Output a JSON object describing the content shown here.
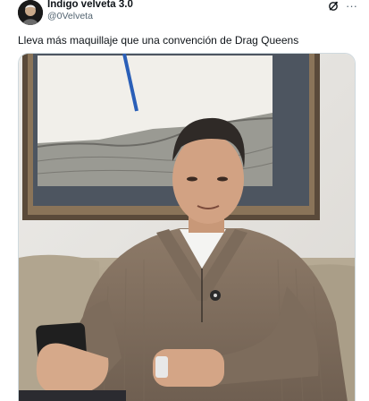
{
  "tweet": {
    "author": {
      "display_name": "Indigo velveta 3.0",
      "handle": "@0Velveta",
      "avatar_icon": "avatar-icon"
    },
    "actions": {
      "grok_icon": "grok-icon",
      "more_icon": "more-options-icon",
      "more_label": "···"
    },
    "text": "Lleva más maquillaje que una convención de Drag Queens",
    "media": {
      "type": "video-still"
    }
  },
  "colors": {
    "text_primary": "#0f1419",
    "text_secondary": "#536471",
    "border": "#cfd9de",
    "background": "#ffffff"
  }
}
